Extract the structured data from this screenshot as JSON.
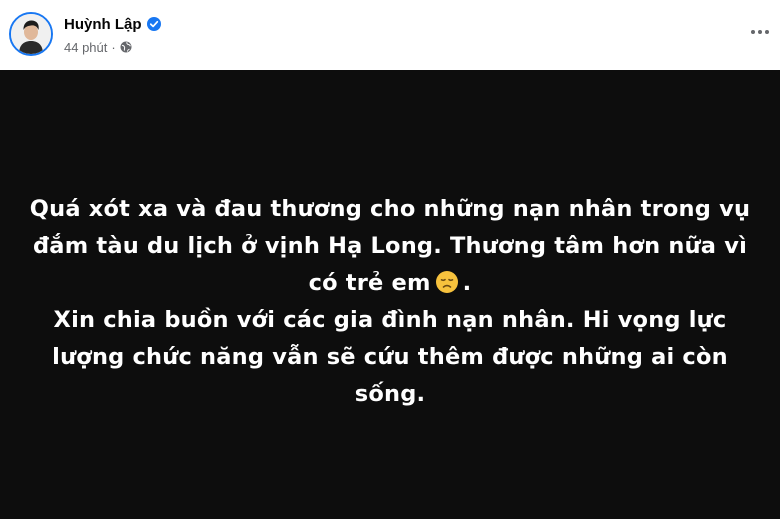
{
  "author": {
    "name": "Huỳnh Lập",
    "verified_icon": "verified-badge-icon",
    "avatar_icon": "avatar"
  },
  "meta": {
    "time": "44 phút",
    "separator": "·",
    "privacy_icon": "globe-icon"
  },
  "actions": {
    "more_icon": "more-options-icon"
  },
  "post": {
    "background": "#0d0d0d",
    "text_color": "#ffffff",
    "lines": {
      "l1": "Quá xót xa và đau thương cho những nạn nhân trong vụ",
      "l2": "đắm tàu du lịch ở vịnh Hạ Long. Thương tâm hơn nữa vì",
      "l3a": "có trẻ em",
      "l3b": ".",
      "l4": "Xin chia buồn với các gia đình nạn nhân. Hi vọng lực",
      "l5": "lượng chức năng vẫn sẽ cứu thêm được những ai còn",
      "l6": "sống."
    },
    "emoji": "disappointed-face-emoji"
  },
  "colors": {
    "brand": "#1877f2",
    "secondary_text": "#65676b",
    "primary_text": "#050505"
  }
}
